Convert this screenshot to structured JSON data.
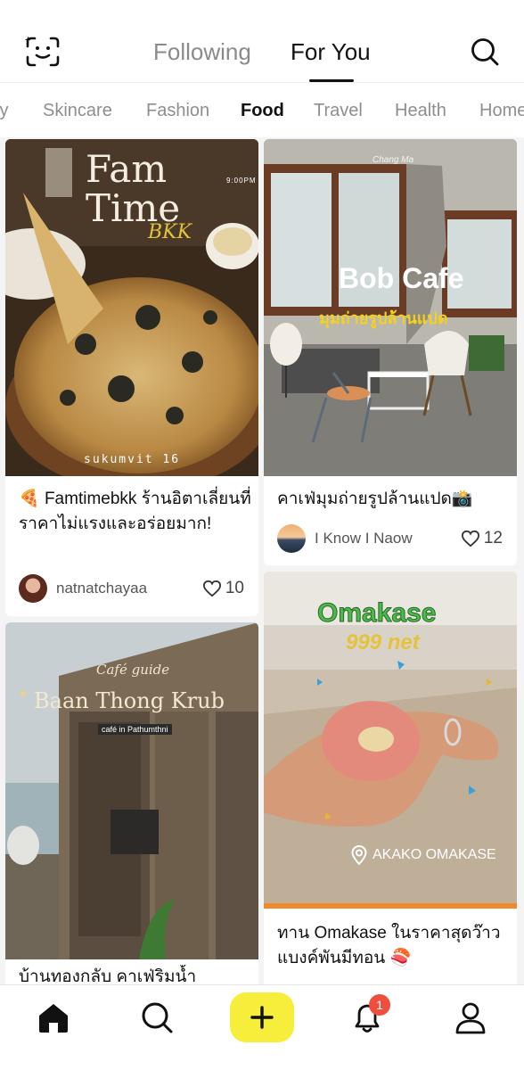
{
  "header": {
    "tabs": [
      {
        "label": "Following",
        "active": false
      },
      {
        "label": "For You",
        "active": true
      }
    ]
  },
  "categories": [
    {
      "label": "ty",
      "active": false
    },
    {
      "label": "Skincare",
      "active": false
    },
    {
      "label": "Fashion",
      "active": false
    },
    {
      "label": "Food",
      "active": true
    },
    {
      "label": "Travel",
      "active": false
    },
    {
      "label": "Health",
      "active": false
    },
    {
      "label": "Home",
      "active": false
    }
  ],
  "posts": [
    {
      "overlay_title": "Fam Time",
      "overlay_script": "BKK",
      "overlay_time": "9:00PM",
      "overlay_location": "sukumvit 16",
      "title_emoji": "🍕",
      "title": "Famtimebkk ร้านอิตาเลี่ยนที่ราคาไม่แรงและอร่อยมาก!",
      "author": "natnatchayaa",
      "likes": "10"
    },
    {
      "overlay_brand": "Chang Ma",
      "overlay_title": "Bob Cafe",
      "overlay_subtitle": "มุมถ่ายรูปล้านแปด",
      "title": "คาเฟ่มุมถ่ายรูปล้านแปด",
      "title_emoji": "📸",
      "author": "I Know I Naow",
      "likes": "12"
    },
    {
      "overlay_small": "Café guide",
      "overlay_title": "Baan Thong Krub",
      "overlay_subtitle": "café in Pathumthni",
      "title": "บ้านทองกลับ คาเฟ่ริมน้ำ"
    },
    {
      "overlay_title": "Omakase",
      "overlay_subtitle": "999 net",
      "overlay_location": "AKAKO OMAKASE",
      "title": "ทาน Omakase ในราคาสุดว๊าว แบงค์พันมีทอน",
      "title_emoji": "🍣"
    }
  ],
  "bottom_nav": {
    "items": [
      "home-icon",
      "search-icon",
      "add-icon",
      "bell-icon",
      "profile-icon"
    ],
    "notification_count": "1"
  },
  "colors": {
    "accent_yellow": "#f6ee3a",
    "badge_red": "#ee4e3b",
    "omakase_green": "#4cba4a"
  }
}
